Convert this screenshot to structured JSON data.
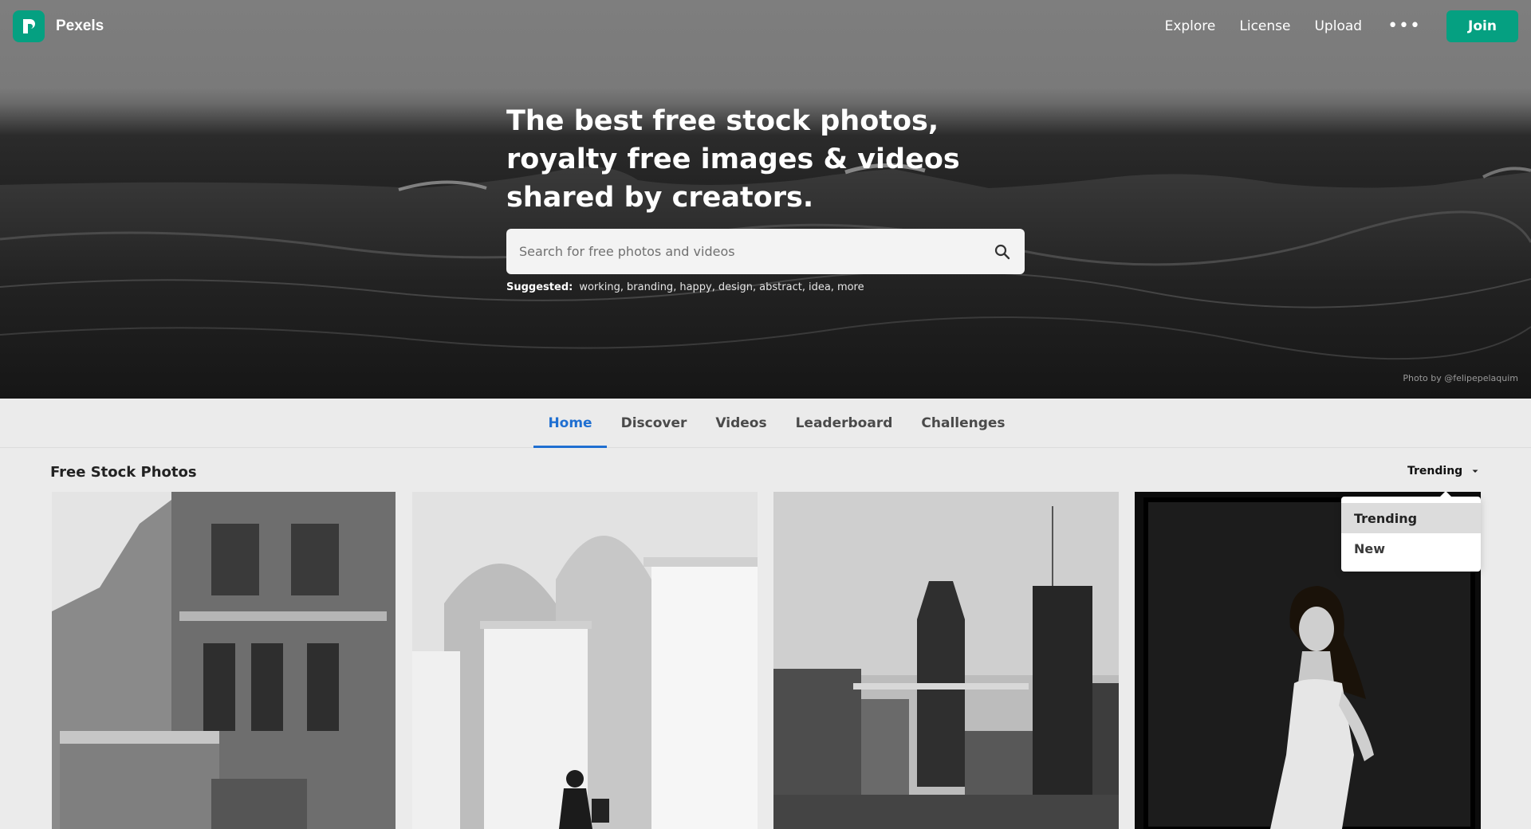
{
  "brand": {
    "name": "Pexels"
  },
  "nav": {
    "links": [
      "Explore",
      "License",
      "Upload"
    ],
    "more_label": "•••",
    "join_label": "Join"
  },
  "hero": {
    "title": "The best free stock photos, royalty free images & videos shared by creators.",
    "search_placeholder": "Search for free photos and videos",
    "suggested_label": "Suggested:",
    "suggested": [
      "working",
      "branding",
      "happy",
      "design",
      "abstract",
      "idea",
      "more"
    ],
    "photo_credit": "Photo by @felipepelaquim"
  },
  "tabs": [
    {
      "label": "Home",
      "active": true
    },
    {
      "label": "Discover",
      "active": false
    },
    {
      "label": "Videos",
      "active": false
    },
    {
      "label": "Leaderboard",
      "active": false
    },
    {
      "label": "Challenges",
      "active": false
    }
  ],
  "section": {
    "title": "Free Stock Photos",
    "sort_value": "Trending",
    "sort_options": [
      "Trending",
      "New"
    ]
  },
  "photos": [
    {
      "subject": "ornate-building"
    },
    {
      "subject": "white-arches-figure"
    },
    {
      "subject": "city-skyline"
    },
    {
      "subject": "woman-portrait"
    }
  ],
  "colors": {
    "accent": "#05a081",
    "tab_active": "#1f6fd1",
    "page_bg": "#ebebeb"
  }
}
